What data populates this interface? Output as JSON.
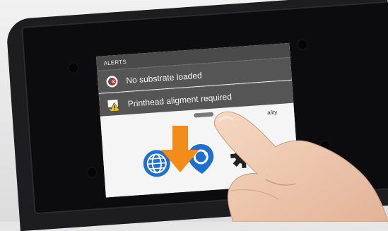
{
  "panel": {
    "header": "ALERTS",
    "alerts": [
      {
        "label": "No substrate loaded",
        "icon": "substrate-error-icon"
      },
      {
        "label": "Printhead aligment required",
        "icon": "printhead-warning-icon"
      }
    ],
    "partial_label": "ality"
  },
  "colors": {
    "bezel": "#1d1d1f",
    "alert_row": "#555555",
    "header": "#4a4a4a",
    "arrow": "#f28c1a",
    "globe": "#1e6fd0"
  }
}
